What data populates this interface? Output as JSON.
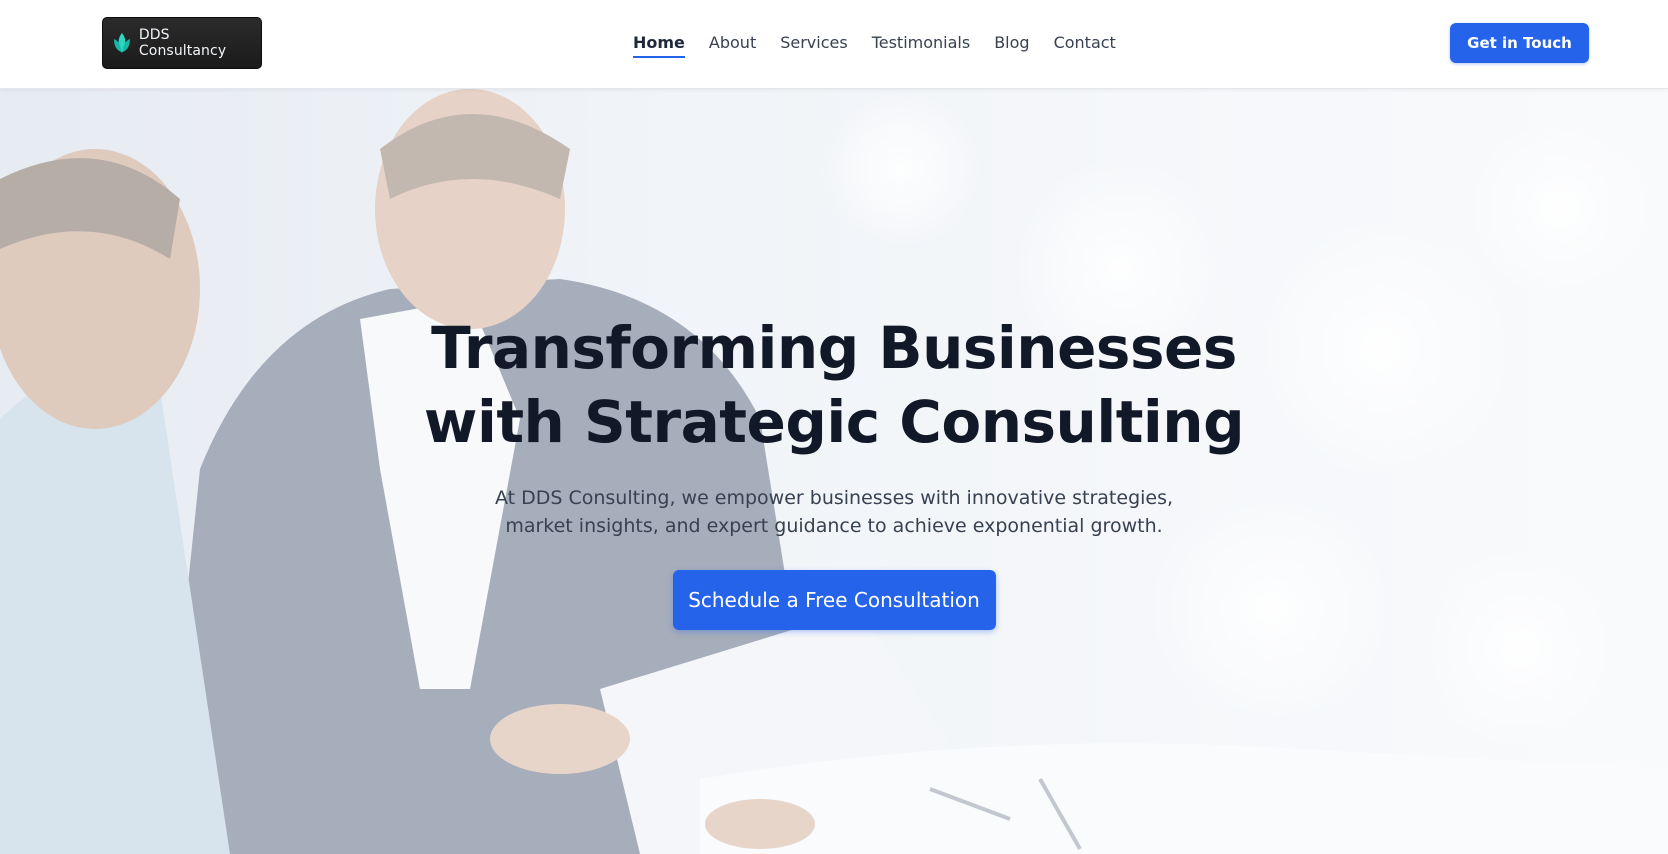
{
  "header": {
    "logo_text": "DDS Consultancy",
    "nav": [
      {
        "label": "Home",
        "active": true
      },
      {
        "label": "About",
        "active": false
      },
      {
        "label": "Services",
        "active": false
      },
      {
        "label": "Testimonials",
        "active": false
      },
      {
        "label": "Blog",
        "active": false
      },
      {
        "label": "Contact",
        "active": false
      }
    ],
    "cta_label": "Get in Touch"
  },
  "hero": {
    "title": "Transforming Businesses with Strategic Consulting",
    "subtitle": "At DDS Consulting, we empower businesses with innovative strategies, market insights, and expert guidance to achieve exponential growth.",
    "cta_label": "Schedule a Free Consultation",
    "background_image": "business-meeting-photo"
  },
  "colors": {
    "accent": "#2563eb",
    "heading": "#111827",
    "body_text": "#374151",
    "header_bg": "#ffffff"
  }
}
